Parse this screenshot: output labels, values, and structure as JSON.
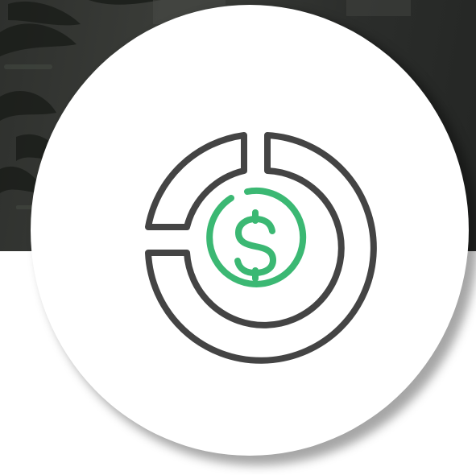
{
  "hero": {
    "icon": "pie-chart-dollar-icon",
    "background": "dark-office-photo-with-plants"
  },
  "colors": {
    "icon_outline": "#444444",
    "icon_accent": "#3bb873",
    "circle_fill": "#ffffff",
    "backdrop": "#2e302d"
  }
}
